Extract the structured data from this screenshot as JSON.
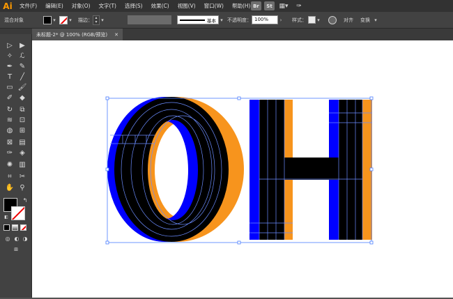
{
  "app": {
    "logo": "Ai"
  },
  "menu": [
    "文件(F)",
    "编辑(E)",
    "对象(O)",
    "文字(T)",
    "选择(S)",
    "效果(C)",
    "视图(V)",
    "窗口(W)",
    "帮助(H)"
  ],
  "menu_right": {
    "br": "Br",
    "st": "St",
    "layout_icon": "grid-icon",
    "brush_icon": "feather-icon"
  },
  "control": {
    "mode_label": "混合对象",
    "stroke_label": "描边：",
    "stroke_style": "基本",
    "opacity_label": "不透明度：",
    "opacity_value": "100%",
    "style_label": "样式：",
    "align_label": "对齐",
    "transform_label": "变换"
  },
  "tab": {
    "title": "未标题-2* @ 100% (RGB/预览)",
    "close": "✕"
  },
  "colors": {
    "accent": "#ff9a00",
    "blue": "#0000ff",
    "orange": "#f7941d",
    "black": "#000000",
    "guide": "#6b8cff"
  }
}
